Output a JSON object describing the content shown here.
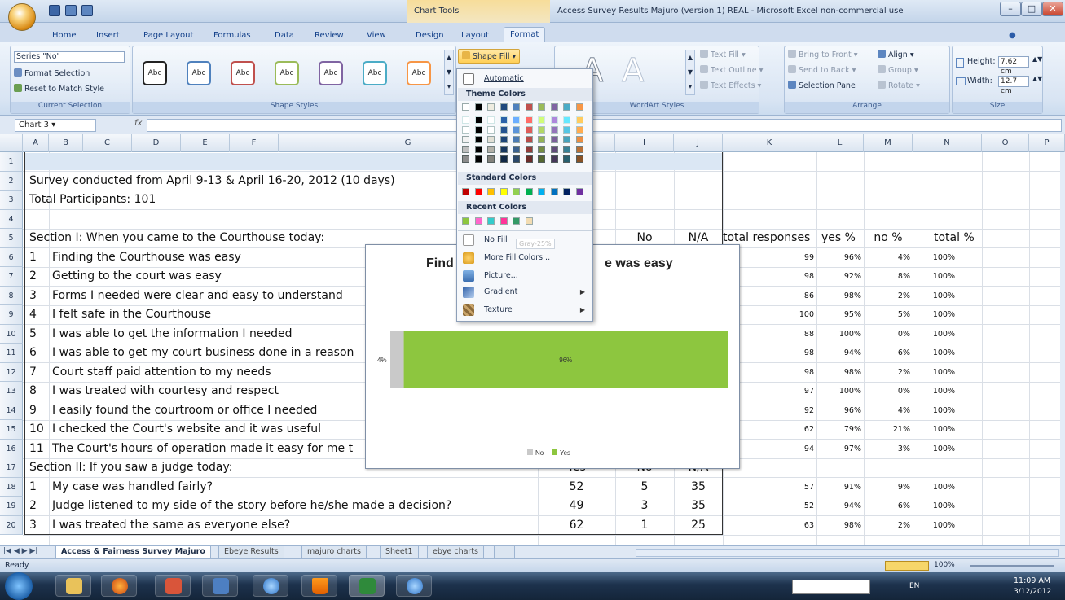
{
  "window": {
    "title": "Access Survey Results Majuro (version 1) REAL - Microsoft Excel non-commercial use",
    "context_title": "Chart Tools"
  },
  "tabs": [
    "Home",
    "Insert",
    "Page Layout",
    "Formulas",
    "Data",
    "Review",
    "View",
    "Design",
    "Layout",
    "Format"
  ],
  "ribbon": {
    "current_selection": {
      "series": "Series \"No\"",
      "format_selection": "Format Selection",
      "reset": "Reset to Match Style",
      "label": "Current Selection"
    },
    "shape_styles": {
      "sample": "Abc",
      "label": "Shape Styles",
      "shape_fill": "Shape Fill"
    },
    "wordart": {
      "text_fill": "Text Fill",
      "text_outline": "Text Outline",
      "text_effects": "Text Effects",
      "label": "WordArt Styles"
    },
    "arrange": {
      "bring_front": "Bring to Front",
      "send_back": "Send to Back",
      "selection_pane": "Selection Pane",
      "align": "Align",
      "group": "Group",
      "rotate": "Rotate",
      "label": "Arrange"
    },
    "size": {
      "height_label": "Height:",
      "height": "7.62 cm",
      "width_label": "Width:",
      "width": "12.7 cm",
      "label": "Size"
    }
  },
  "formula_bar": {
    "name_box": "Chart 3",
    "fx": "fx"
  },
  "columns": [
    "A",
    "B",
    "C",
    "D",
    "E",
    "F",
    "G",
    "H",
    "I",
    "J",
    "K",
    "L",
    "M",
    "N",
    "O",
    "P"
  ],
  "rows": {
    "numbers": [
      "1",
      "2",
      "3",
      "4",
      "5",
      "6",
      "7",
      "8",
      "9",
      "10",
      "11",
      "12",
      "13",
      "14",
      "15",
      "16",
      "17",
      "18",
      "19",
      "20"
    ],
    "survey_dates": "Survey conducted from April 9-13 & April 16-20, 2012  (10 days)",
    "participants": "Total Participants:  101",
    "section1": "Section I:  When you came to the Courthouse today:",
    "section1_no": "No",
    "section1_na": "N/A",
    "section2": "Section II:  If you saw a judge today:",
    "headers_right": [
      "total responses",
      "yes %",
      "no %",
      "total %"
    ],
    "section2_headers": [
      "Yes",
      "No",
      "N/A"
    ],
    "items1": [
      {
        "n": "1",
        "text": "Finding the Courthouse was easy",
        "total": "99",
        "yes": "96%",
        "no": "4%",
        "tot": "100%"
      },
      {
        "n": "2",
        "text": "Getting to the court was easy",
        "total": "98",
        "yes": "92%",
        "no": "8%",
        "tot": "100%"
      },
      {
        "n": "3",
        "text": "Forms I needed were clear and easy to understand",
        "total": "86",
        "yes": "98%",
        "no": "2%",
        "tot": "100%"
      },
      {
        "n": "4",
        "text": "I felt safe in the Courthouse",
        "total": "100",
        "yes": "95%",
        "no": "5%",
        "tot": "100%"
      },
      {
        "n": "5",
        "text": "I was able to get the information I needed",
        "total": "88",
        "yes": "100%",
        "no": "0%",
        "tot": "100%"
      },
      {
        "n": "6",
        "text": "I was able to get my court business done in a reason",
        "total": "98",
        "yes": "94%",
        "no": "6%",
        "tot": "100%"
      },
      {
        "n": "7",
        "text": "Court staff paid attention to my needs",
        "total": "98",
        "yes": "98%",
        "no": "2%",
        "tot": "100%"
      },
      {
        "n": "8",
        "text": "I was treated with courtesy and respect",
        "total": "97",
        "yes": "100%",
        "no": "0%",
        "tot": "100%"
      },
      {
        "n": "9",
        "text": "I easily found the courtroom or office I needed",
        "total": "92",
        "yes": "96%",
        "no": "4%",
        "tot": "100%"
      },
      {
        "n": "10",
        "text": "I checked the Court's website and it was useful",
        "total": "62",
        "yes": "79%",
        "no": "21%",
        "tot": "100%"
      },
      {
        "n": "11",
        "text": "The Court's hours of operation made it easy for me t",
        "total": "94",
        "yes": "97%",
        "no": "3%",
        "tot": "100%"
      }
    ],
    "items2": [
      {
        "n": "1",
        "text": "My case was handled fairly?",
        "y": "52",
        "no": "5",
        "na": "35",
        "total": "57",
        "yes": "91%",
        "nop": "9%",
        "tot": "100%"
      },
      {
        "n": "2",
        "text": "Judge listened to my side of the story before he/she made a decision?",
        "y": "49",
        "no": "3",
        "na": "35",
        "total": "52",
        "yes": "94%",
        "nop": "6%",
        "tot": "100%"
      },
      {
        "n": "3",
        "text": "I was treated the same as everyone else?",
        "y": "62",
        "no": "1",
        "na": "25",
        "total": "63",
        "yes": "98%",
        "nop": "2%",
        "tot": "100%"
      }
    ]
  },
  "chart_data": {
    "type": "bar",
    "stacked": true,
    "orientation": "horizontal",
    "title_left": "Find",
    "title_right": "e was easy",
    "categories": [
      ""
    ],
    "series": [
      {
        "name": "No",
        "values": [
          4
        ],
        "label": "4%",
        "color": "#c9c9c9"
      },
      {
        "name": "Yes",
        "values": [
          96
        ],
        "label": "96%",
        "color": "#8dc63f"
      }
    ],
    "legend": "bottom"
  },
  "shape_fill_menu": {
    "automatic": "Automatic",
    "theme_colors": "Theme Colors",
    "standard_colors": "Standard Colors",
    "recent_colors": "Recent Colors",
    "no_fill": "No Fill",
    "tooltip": "Gray-25%",
    "more_colors": "More Fill Colors...",
    "picture": "Picture...",
    "gradient": "Gradient",
    "texture": "Texture",
    "theme_top": [
      "#ffffff",
      "#000000",
      "#eeece1",
      "#1f497d",
      "#4f81bd",
      "#c0504d",
      "#9bbb59",
      "#8064a2",
      "#4bacc6",
      "#f79646"
    ],
    "standard": [
      "#c00000",
      "#ff0000",
      "#ffc000",
      "#ffff00",
      "#92d050",
      "#00b050",
      "#00b0f0",
      "#0070c0",
      "#002060",
      "#7030a0"
    ],
    "recent": [
      "#8dc63f",
      "#ff66cc",
      "#33cccc",
      "#ff3399",
      "#339966",
      "#f2dcb2"
    ]
  },
  "sheets": [
    "Access & Fairness Survey Majuro",
    "Ebeye Results",
    "majuro charts",
    "Sheet1",
    "ebye charts"
  ],
  "status": {
    "ready": "Ready",
    "zoom": "100%"
  },
  "taskbar": {
    "lang": "EN",
    "time": "11:09 AM",
    "date": "3/12/2012"
  }
}
